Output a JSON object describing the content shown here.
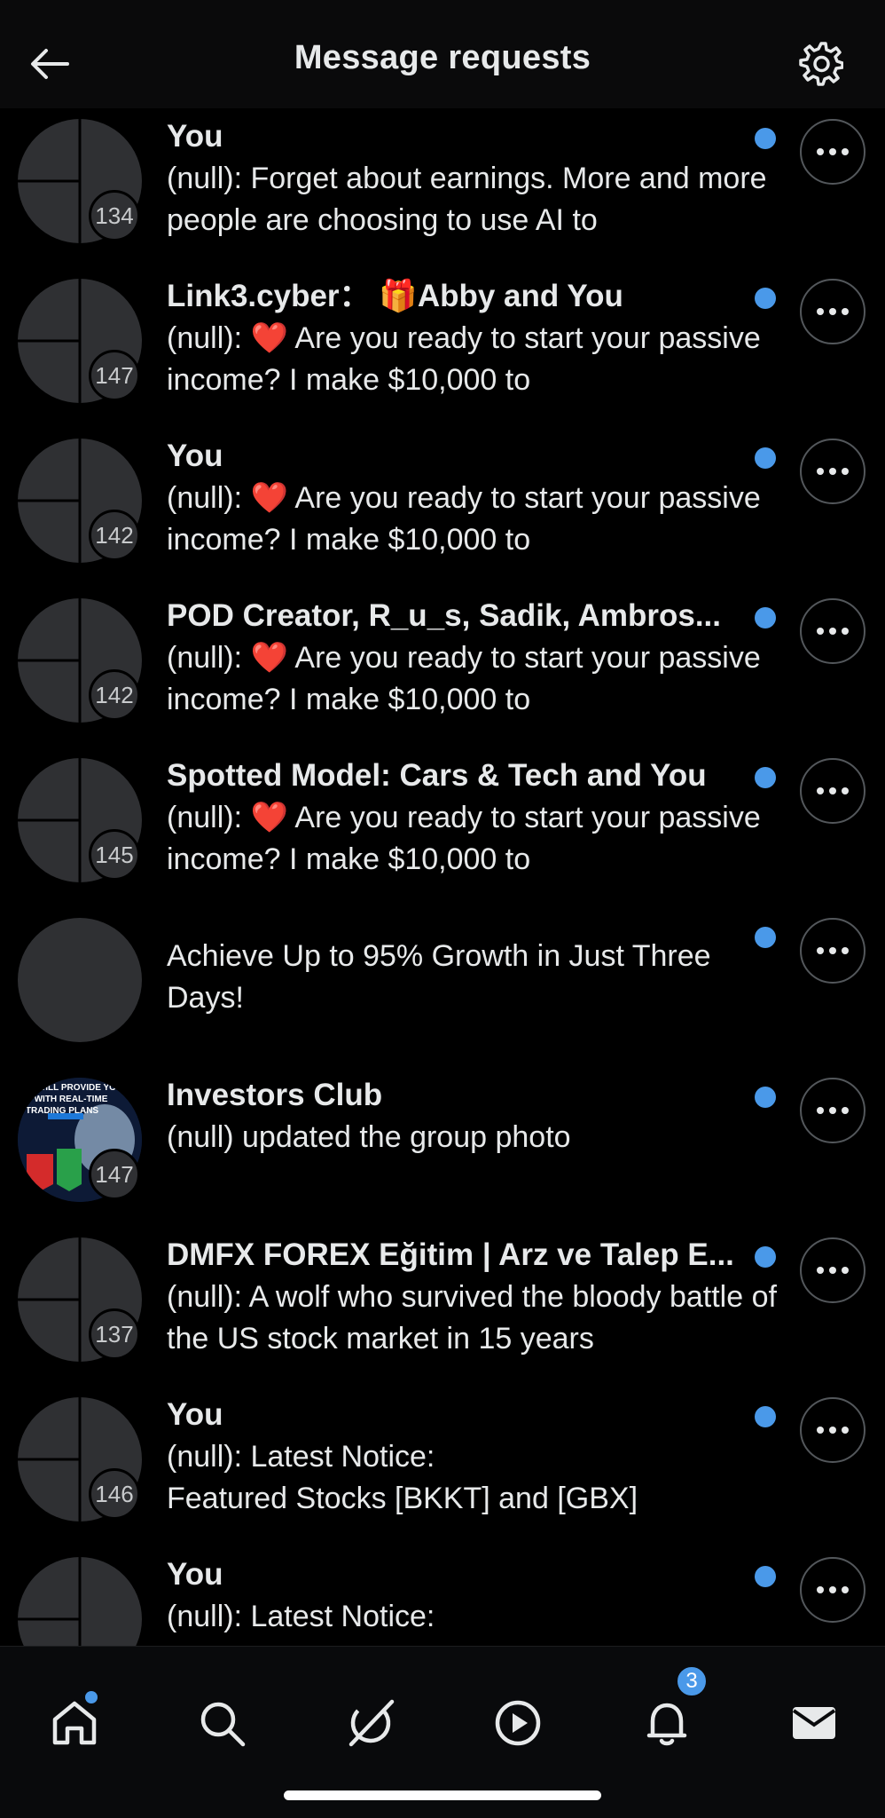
{
  "header": {
    "title": "Message requests"
  },
  "conversations": [
    {
      "name": "You",
      "preview": "(null): Forget about earnings. More and more people are choosing to use AI to",
      "count": "134",
      "heart": false
    },
    {
      "name": "Link3.cyber： 🎁Abby and You",
      "preview": "Are you ready to start your passive income? I make $10,000 to",
      "count": "147",
      "heart": true
    },
    {
      "name": "You",
      "preview": "Are you ready to start your passive income? I make $10,000 to",
      "count": "142",
      "heart": true
    },
    {
      "name": "POD Creator, R_u_s, Sadik, Ambros...",
      "preview": "Are you ready to start your passive income? I make $10,000 to",
      "count": "142",
      "heart": true
    },
    {
      "name": "Spotted Model: Cars & Tech and You",
      "preview": "Are you ready to start your passive income? I make $10,000 to",
      "count": "145",
      "heart": true
    },
    {
      "name": "",
      "preview": "Achieve Up to 95% Growth in Just Three Days!",
      "count": "",
      "heart": false
    },
    {
      "name": "Investors Club",
      "preview": "(null) updated the group photo",
      "count": "147",
      "heart": false
    },
    {
      "name": "DMFX FOREX Eğitim | Arz ve Talep E...",
      "preview": "(null): A wolf who survived the bloody battle of the US stock market in 15 years",
      "count": "137",
      "heart": false
    },
    {
      "name": "You",
      "preview": "(null): Latest Notice:\nFeatured Stocks [BKKT] and [GBX]",
      "count": "146",
      "heart": false
    },
    {
      "name": "You",
      "preview": "(null): Latest Notice:",
      "count": "",
      "heart": false
    }
  ],
  "heart_prefix": "(null): ",
  "avatar_thumb_text": [
    "WILL PROVIDE YOU",
    "WITH REAL-TIME",
    "TRADING PLANS"
  ],
  "tabbar": {
    "notifications_badge": "3"
  },
  "colors": {
    "accent": "#4a99e9",
    "heart": "#e0242e",
    "background": "#000000"
  }
}
